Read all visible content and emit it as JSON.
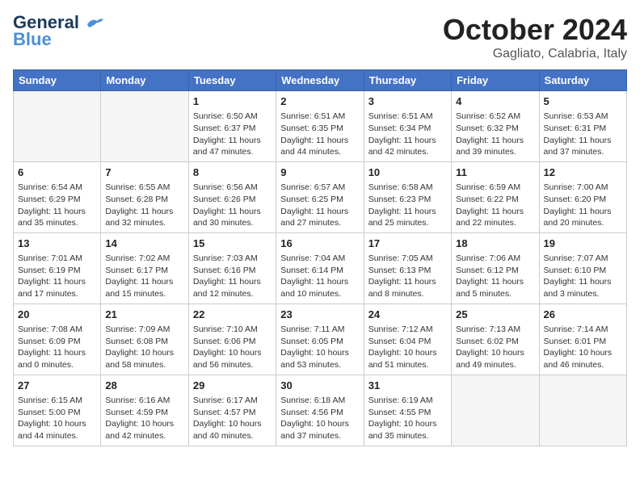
{
  "header": {
    "logo_line1": "General",
    "logo_line2": "Blue",
    "month": "October 2024",
    "location": "Gagliato, Calabria, Italy"
  },
  "days_of_week": [
    "Sunday",
    "Monday",
    "Tuesday",
    "Wednesday",
    "Thursday",
    "Friday",
    "Saturday"
  ],
  "weeks": [
    [
      {
        "day": "",
        "info": ""
      },
      {
        "day": "",
        "info": ""
      },
      {
        "day": "1",
        "info": "Sunrise: 6:50 AM\nSunset: 6:37 PM\nDaylight: 11 hours and 47 minutes."
      },
      {
        "day": "2",
        "info": "Sunrise: 6:51 AM\nSunset: 6:35 PM\nDaylight: 11 hours and 44 minutes."
      },
      {
        "day": "3",
        "info": "Sunrise: 6:51 AM\nSunset: 6:34 PM\nDaylight: 11 hours and 42 minutes."
      },
      {
        "day": "4",
        "info": "Sunrise: 6:52 AM\nSunset: 6:32 PM\nDaylight: 11 hours and 39 minutes."
      },
      {
        "day": "5",
        "info": "Sunrise: 6:53 AM\nSunset: 6:31 PM\nDaylight: 11 hours and 37 minutes."
      }
    ],
    [
      {
        "day": "6",
        "info": "Sunrise: 6:54 AM\nSunset: 6:29 PM\nDaylight: 11 hours and 35 minutes."
      },
      {
        "day": "7",
        "info": "Sunrise: 6:55 AM\nSunset: 6:28 PM\nDaylight: 11 hours and 32 minutes."
      },
      {
        "day": "8",
        "info": "Sunrise: 6:56 AM\nSunset: 6:26 PM\nDaylight: 11 hours and 30 minutes."
      },
      {
        "day": "9",
        "info": "Sunrise: 6:57 AM\nSunset: 6:25 PM\nDaylight: 11 hours and 27 minutes."
      },
      {
        "day": "10",
        "info": "Sunrise: 6:58 AM\nSunset: 6:23 PM\nDaylight: 11 hours and 25 minutes."
      },
      {
        "day": "11",
        "info": "Sunrise: 6:59 AM\nSunset: 6:22 PM\nDaylight: 11 hours and 22 minutes."
      },
      {
        "day": "12",
        "info": "Sunrise: 7:00 AM\nSunset: 6:20 PM\nDaylight: 11 hours and 20 minutes."
      }
    ],
    [
      {
        "day": "13",
        "info": "Sunrise: 7:01 AM\nSunset: 6:19 PM\nDaylight: 11 hours and 17 minutes."
      },
      {
        "day": "14",
        "info": "Sunrise: 7:02 AM\nSunset: 6:17 PM\nDaylight: 11 hours and 15 minutes."
      },
      {
        "day": "15",
        "info": "Sunrise: 7:03 AM\nSunset: 6:16 PM\nDaylight: 11 hours and 12 minutes."
      },
      {
        "day": "16",
        "info": "Sunrise: 7:04 AM\nSunset: 6:14 PM\nDaylight: 11 hours and 10 minutes."
      },
      {
        "day": "17",
        "info": "Sunrise: 7:05 AM\nSunset: 6:13 PM\nDaylight: 11 hours and 8 minutes."
      },
      {
        "day": "18",
        "info": "Sunrise: 7:06 AM\nSunset: 6:12 PM\nDaylight: 11 hours and 5 minutes."
      },
      {
        "day": "19",
        "info": "Sunrise: 7:07 AM\nSunset: 6:10 PM\nDaylight: 11 hours and 3 minutes."
      }
    ],
    [
      {
        "day": "20",
        "info": "Sunrise: 7:08 AM\nSunset: 6:09 PM\nDaylight: 11 hours and 0 minutes."
      },
      {
        "day": "21",
        "info": "Sunrise: 7:09 AM\nSunset: 6:08 PM\nDaylight: 10 hours and 58 minutes."
      },
      {
        "day": "22",
        "info": "Sunrise: 7:10 AM\nSunset: 6:06 PM\nDaylight: 10 hours and 56 minutes."
      },
      {
        "day": "23",
        "info": "Sunrise: 7:11 AM\nSunset: 6:05 PM\nDaylight: 10 hours and 53 minutes."
      },
      {
        "day": "24",
        "info": "Sunrise: 7:12 AM\nSunset: 6:04 PM\nDaylight: 10 hours and 51 minutes."
      },
      {
        "day": "25",
        "info": "Sunrise: 7:13 AM\nSunset: 6:02 PM\nDaylight: 10 hours and 49 minutes."
      },
      {
        "day": "26",
        "info": "Sunrise: 7:14 AM\nSunset: 6:01 PM\nDaylight: 10 hours and 46 minutes."
      }
    ],
    [
      {
        "day": "27",
        "info": "Sunrise: 6:15 AM\nSunset: 5:00 PM\nDaylight: 10 hours and 44 minutes."
      },
      {
        "day": "28",
        "info": "Sunrise: 6:16 AM\nSunset: 4:59 PM\nDaylight: 10 hours and 42 minutes."
      },
      {
        "day": "29",
        "info": "Sunrise: 6:17 AM\nSunset: 4:57 PM\nDaylight: 10 hours and 40 minutes."
      },
      {
        "day": "30",
        "info": "Sunrise: 6:18 AM\nSunset: 4:56 PM\nDaylight: 10 hours and 37 minutes."
      },
      {
        "day": "31",
        "info": "Sunrise: 6:19 AM\nSunset: 4:55 PM\nDaylight: 10 hours and 35 minutes."
      },
      {
        "day": "",
        "info": ""
      },
      {
        "day": "",
        "info": ""
      }
    ]
  ]
}
